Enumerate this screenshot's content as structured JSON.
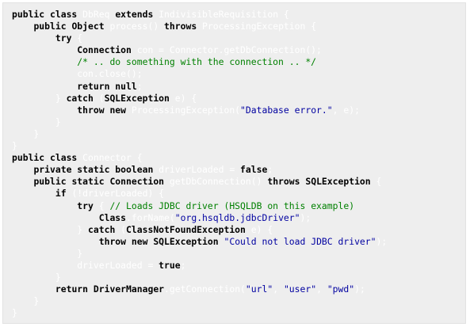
{
  "code": {
    "lines": [
      [
        [
          "kw",
          "public class"
        ],
        [
          "pl",
          " DbReq "
        ],
        [
          "kw",
          "extends"
        ],
        [
          "pl",
          " IndivisibleRequisition {"
        ]
      ],
      [
        [
          "pl",
          "    "
        ],
        [
          "kw",
          "public"
        ],
        [
          "pl",
          " "
        ],
        [
          "ty",
          "Object"
        ],
        [
          "pl",
          " process() "
        ],
        [
          "kw",
          "throws"
        ],
        [
          "pl",
          " ProcessingException {"
        ]
      ],
      [
        [
          "pl",
          "        "
        ],
        [
          "kw",
          "try"
        ],
        [
          "pl",
          " {"
        ]
      ],
      [
        [
          "pl",
          "            "
        ],
        [
          "ty",
          "Connection"
        ],
        [
          "pl",
          " con = Connector.getDbConnection();"
        ]
      ],
      [
        [
          "pl",
          "            "
        ],
        [
          "cm",
          "/* .. do something with the connection .. */"
        ]
      ],
      [
        [
          "pl",
          "            con.close();"
        ]
      ],
      [
        [
          "pl",
          "            "
        ],
        [
          "kw",
          "return null"
        ],
        [
          "pl",
          ";"
        ]
      ],
      [
        [
          "pl",
          "        } "
        ],
        [
          "kw",
          "catch"
        ],
        [
          "pl",
          " ("
        ],
        [
          "ty",
          "SQLException"
        ],
        [
          "pl",
          " e) {"
        ]
      ],
      [
        [
          "pl",
          "            "
        ],
        [
          "kw",
          "throw new"
        ],
        [
          "pl",
          " ProcessingException("
        ],
        [
          "st",
          "\"Database error.\""
        ],
        [
          "pl",
          ", e);"
        ]
      ],
      [
        [
          "pl",
          "        }"
        ]
      ],
      [
        [
          "pl",
          "    }"
        ]
      ],
      [
        [
          "pl",
          "}"
        ]
      ],
      [
        [
          "kw",
          "public class"
        ],
        [
          "pl",
          " Connector {"
        ]
      ],
      [
        [
          "pl",
          "    "
        ],
        [
          "kw",
          "private static boolean"
        ],
        [
          "pl",
          " driverLoaded = "
        ],
        [
          "kw",
          "false"
        ],
        [
          "pl",
          ";"
        ]
      ],
      [
        [
          "pl",
          "    "
        ],
        [
          "kw",
          "public static"
        ],
        [
          "pl",
          " "
        ],
        [
          "ty",
          "Connection"
        ],
        [
          "pl",
          " getDbConnection() "
        ],
        [
          "kw",
          "throws"
        ],
        [
          "pl",
          " "
        ],
        [
          "ty",
          "SQLException"
        ],
        [
          "pl",
          " {"
        ]
      ],
      [
        [
          "pl",
          "        "
        ],
        [
          "kw",
          "if"
        ],
        [
          "pl",
          " (!driverLoaded) {"
        ]
      ],
      [
        [
          "pl",
          "            "
        ],
        [
          "kw",
          "try"
        ],
        [
          "pl",
          " { "
        ],
        [
          "cm",
          "// Loads JDBC driver (HSQLDB on this example)"
        ]
      ],
      [
        [
          "pl",
          "                "
        ],
        [
          "ty",
          "Class"
        ],
        [
          "pl",
          ".forName("
        ],
        [
          "st",
          "\"org.hsqldb.jdbcDriver\""
        ],
        [
          "pl",
          ");"
        ]
      ],
      [
        [
          "pl",
          "            } "
        ],
        [
          "kw",
          "catch"
        ],
        [
          "pl",
          " ("
        ],
        [
          "ty",
          "ClassNotFoundException"
        ],
        [
          "pl",
          " e) {"
        ]
      ],
      [
        [
          "pl",
          "                "
        ],
        [
          "kw",
          "throw new"
        ],
        [
          "pl",
          " "
        ],
        [
          "ty",
          "SQLException"
        ],
        [
          "pl",
          " "
        ],
        [
          "st",
          "\"Could not load JDBC driver\""
        ],
        [
          "pl",
          ");"
        ]
      ],
      [
        [
          "pl",
          "            }"
        ]
      ],
      [
        [
          "pl",
          "            driverLoaded = "
        ],
        [
          "kw",
          "true"
        ],
        [
          "pl",
          ";"
        ]
      ],
      [
        [
          "pl",
          "        }"
        ]
      ],
      [
        [
          "pl",
          "        "
        ],
        [
          "kw",
          "return"
        ],
        [
          "pl",
          " "
        ],
        [
          "ty",
          "DriverManager"
        ],
        [
          "pl",
          ".getConnection("
        ],
        [
          "st",
          "\"url\""
        ],
        [
          "pl",
          ", "
        ],
        [
          "st",
          "\"user\""
        ],
        [
          "pl",
          ", "
        ],
        [
          "st",
          "\"pwd\""
        ],
        [
          "pl",
          ");"
        ]
      ],
      [
        [
          "pl",
          "    }"
        ]
      ],
      [
        [
          "pl",
          "}"
        ]
      ]
    ]
  }
}
